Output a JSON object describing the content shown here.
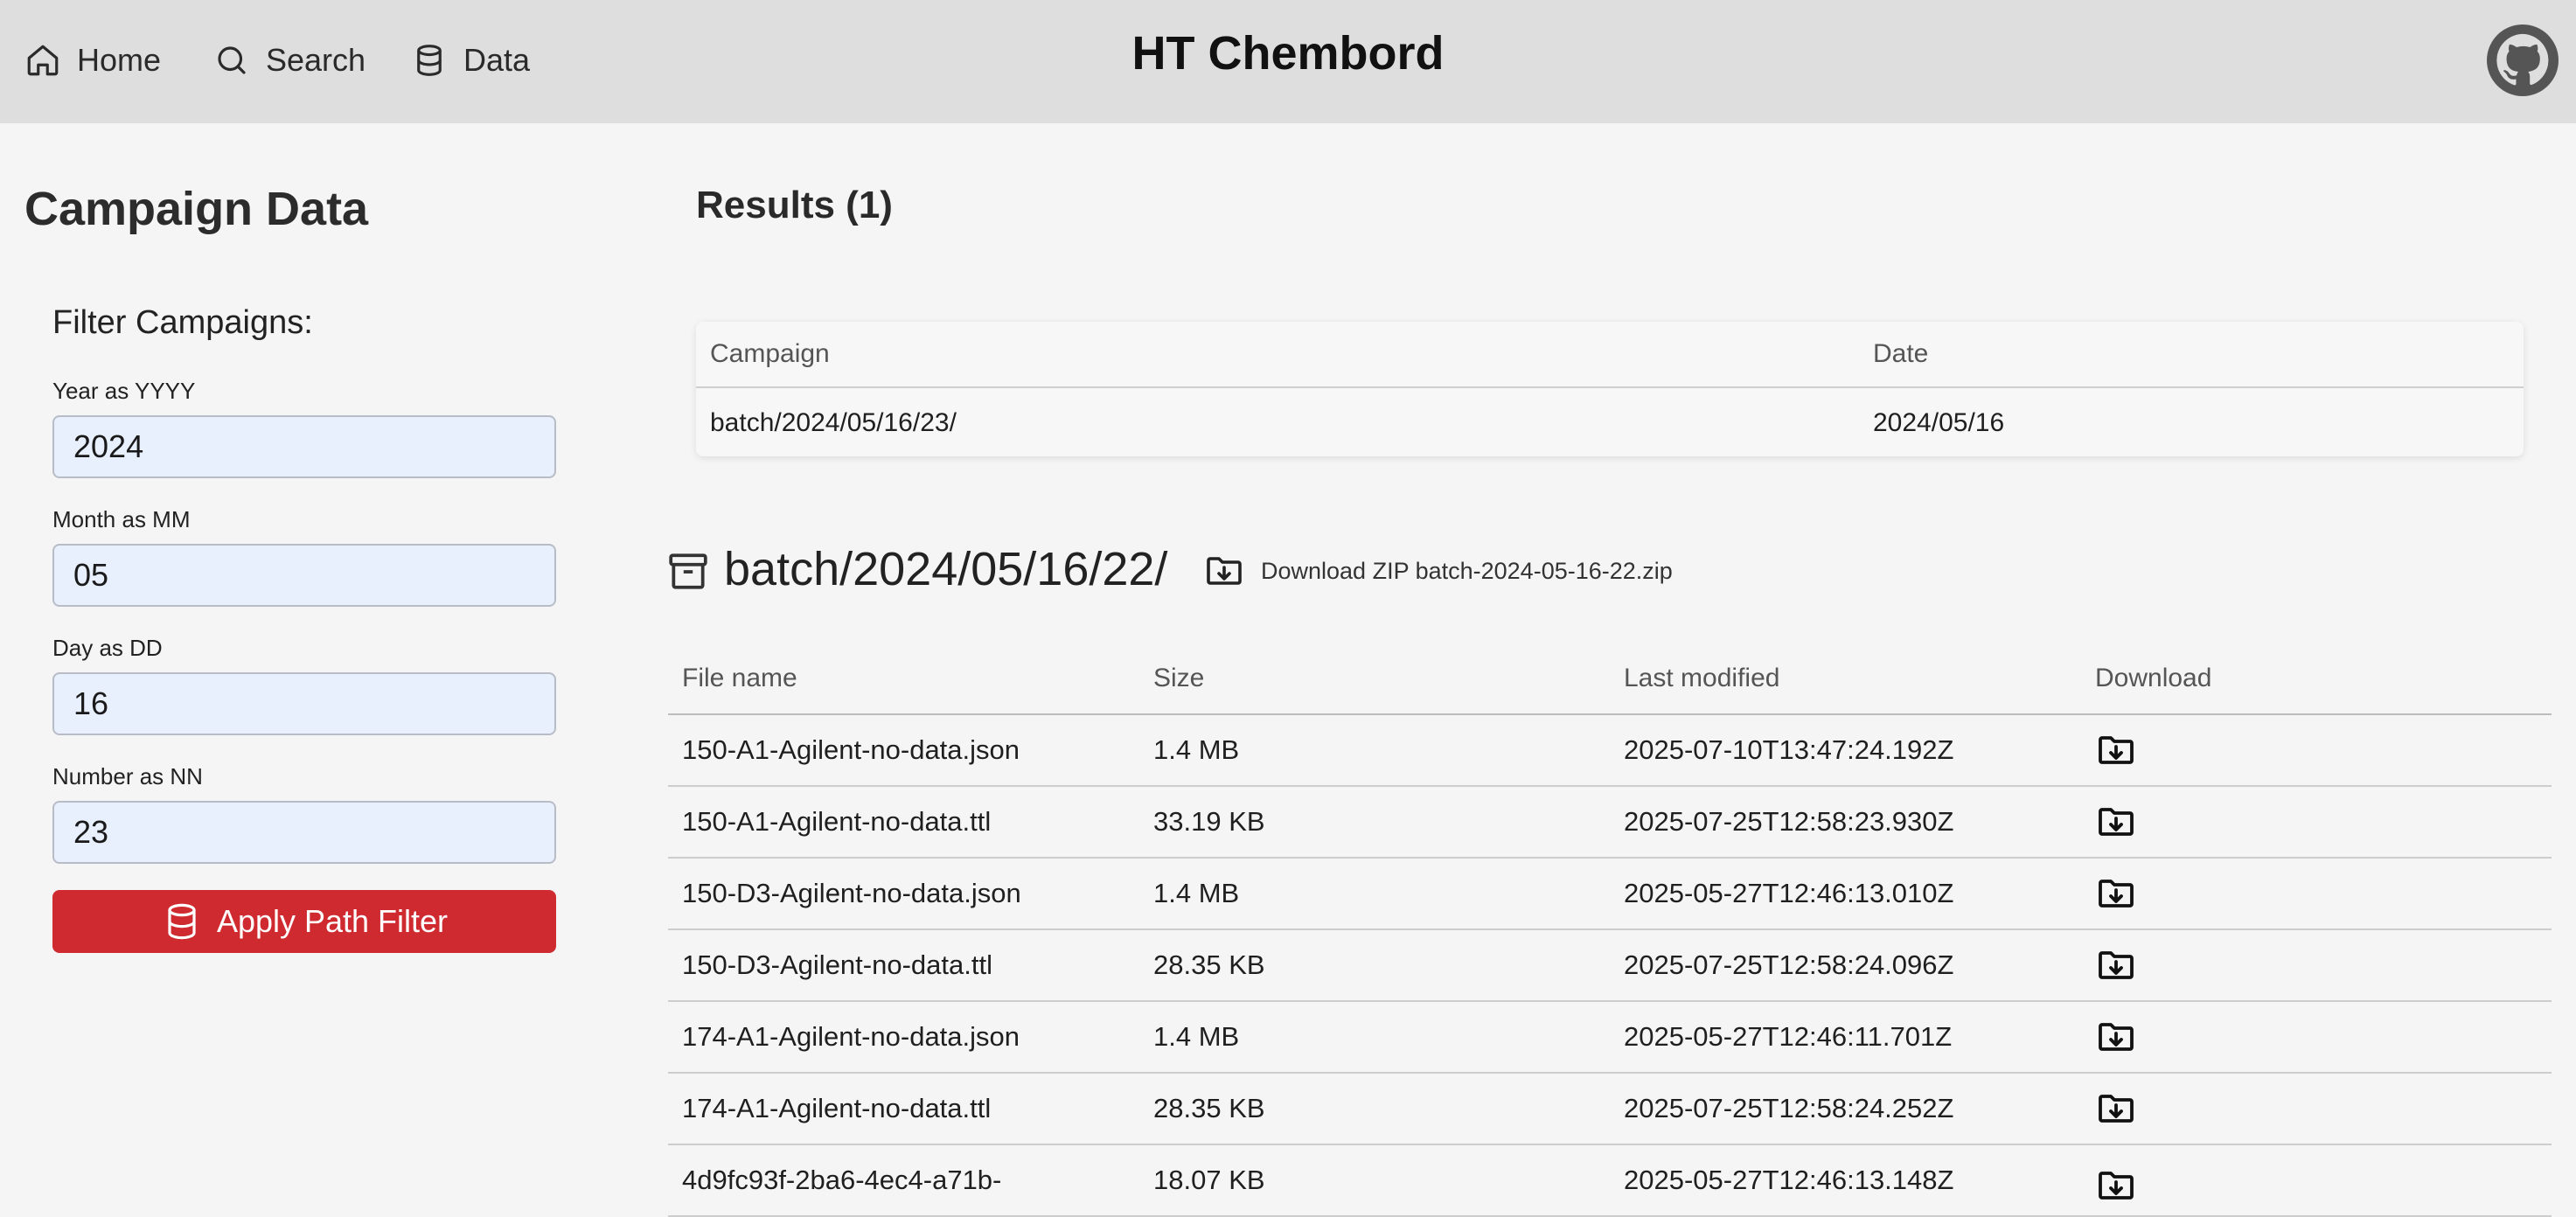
{
  "nav": {
    "items": [
      {
        "label": "Home",
        "icon": "home-icon"
      },
      {
        "label": "Search",
        "icon": "search-icon"
      },
      {
        "label": "Data",
        "icon": "database-icon"
      }
    ],
    "brand": "HT Chembord",
    "github_icon": "github-icon"
  },
  "sidebar": {
    "title": "Campaign Data",
    "filter_heading": "Filter Campaigns:",
    "fields": [
      {
        "label": "Year as YYYY",
        "value": "2024"
      },
      {
        "label": "Month as MM",
        "value": "05"
      },
      {
        "label": "Day as DD",
        "value": "16"
      },
      {
        "label": "Number as NN",
        "value": "23"
      }
    ],
    "apply_label": "Apply Path Filter",
    "apply_color": "#cf2a30"
  },
  "results": {
    "title": "Results (1)",
    "headers": {
      "campaign": "Campaign",
      "date": "Date"
    },
    "rows": [
      {
        "campaign": "batch/2024/05/16/23/",
        "date": "2024/05/16"
      }
    ]
  },
  "batch": {
    "title": "batch/2024/05/16/22/",
    "zip_label": "Download ZIP batch-2024-05-16-22.zip",
    "headers": {
      "name": "File name",
      "size": "Size",
      "modified": "Last modified",
      "download": "Download"
    },
    "files": [
      {
        "name": "150-A1-Agilent-no-data.json",
        "size": "1.4 MB",
        "modified": "2025-07-10T13:47:24.192Z"
      },
      {
        "name": "150-A1-Agilent-no-data.ttl",
        "size": "33.19 KB",
        "modified": "2025-07-25T12:58:23.930Z"
      },
      {
        "name": "150-D3-Agilent-no-data.json",
        "size": "1.4 MB",
        "modified": "2025-05-27T12:46:13.010Z"
      },
      {
        "name": "150-D3-Agilent-no-data.ttl",
        "size": "28.35 KB",
        "modified": "2025-07-25T12:58:24.096Z"
      },
      {
        "name": "174-A1-Agilent-no-data.json",
        "size": "1.4 MB",
        "modified": "2025-05-27T12:46:11.701Z"
      },
      {
        "name": "174-A1-Agilent-no-data.ttl",
        "size": "28.35 KB",
        "modified": "2025-07-25T12:58:24.252Z"
      },
      {
        "name": "4d9fc93f-2ba6-4ec4-a71b-",
        "size": "18.07 KB",
        "modified": "2025-05-27T12:46:13.148Z"
      }
    ]
  }
}
